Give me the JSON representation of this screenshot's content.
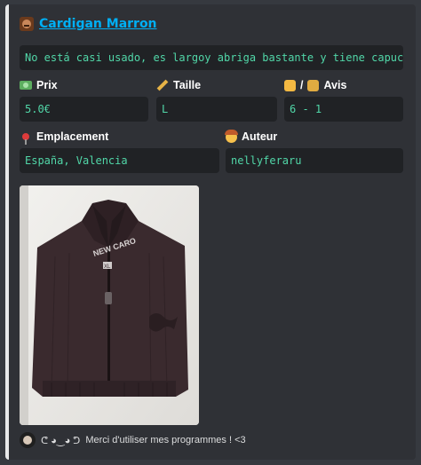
{
  "embed": {
    "title": "Cardigan Marron",
    "description": "No está casi usado, es largoy abriga bastante y tiene capucha",
    "fields": {
      "price": {
        "label": "Prix",
        "value": "5.0€"
      },
      "size": {
        "label": "Taille",
        "value": "L"
      },
      "rating": {
        "label": "Avis",
        "value": "6 - 1"
      },
      "location": {
        "label": "Emplacement",
        "value": "España, Valencia"
      },
      "author": {
        "label": "Auteur",
        "value": "nellyferaru"
      }
    },
    "photo_alt": "Photo of a dark brown zip cardigan",
    "garment_brand_text": "NEW CARO",
    "garment_size_tag": "XL",
    "footer": {
      "face": "ᕦ ◕‿◕ ᕤ",
      "text": "Merci d'utiliser mes programmes ! <3"
    }
  },
  "colors": {
    "background": "#36393f",
    "embed_background": "#2f3136",
    "embed_border": "#e8e9ea",
    "link": "#00aff4",
    "code_text": "#51d7a8",
    "code_background": "#202225"
  }
}
